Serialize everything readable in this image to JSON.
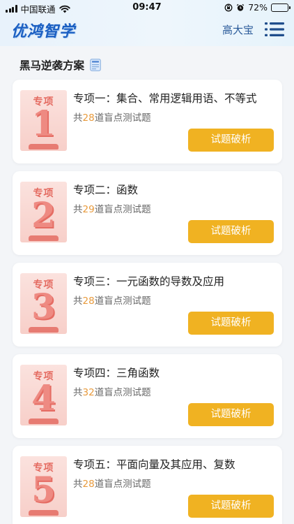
{
  "status_bar": {
    "carrier": "中国联通",
    "time": "09:47",
    "battery": "72%",
    "battery_level": 0.72
  },
  "header": {
    "logo_text": "优鸿智学",
    "username": "高大宝",
    "menu_icon": "hamburger-menu-icon"
  },
  "section": {
    "title": "黑马逆袭方案",
    "icon": "document-icon"
  },
  "cards": [
    {
      "tag": "专项",
      "number": "1",
      "title": "专项一：集合、常用逻辑用语、不等式",
      "prefix": "共",
      "count": "28",
      "suffix": "道盲点测试题",
      "button": "试题破析"
    },
    {
      "tag": "专项",
      "number": "2",
      "title": "专项二：函数",
      "prefix": "共",
      "count": "29",
      "suffix": "道盲点测试题",
      "button": "试题破析"
    },
    {
      "tag": "专项",
      "number": "3",
      "title": "专项三：一元函数的导数及应用",
      "prefix": "共",
      "count": "28",
      "suffix": "道盲点测试题",
      "button": "试题破析"
    },
    {
      "tag": "专项",
      "number": "4",
      "title": "专项四：三角函数",
      "prefix": "共",
      "count": "32",
      "suffix": "道盲点测试题",
      "button": "试题破析"
    },
    {
      "tag": "专项",
      "number": "5",
      "title": "专项五：平面向量及其应用、复数",
      "prefix": "共",
      "count": "28",
      "suffix": "道盲点测试题",
      "button": "试题破析"
    }
  ],
  "colors": {
    "accent_button": "#f0b222",
    "count_highlight": "#e89a3c",
    "logo_blue": "#1b5fc2",
    "thumb_pink": "#f7cfc9"
  }
}
